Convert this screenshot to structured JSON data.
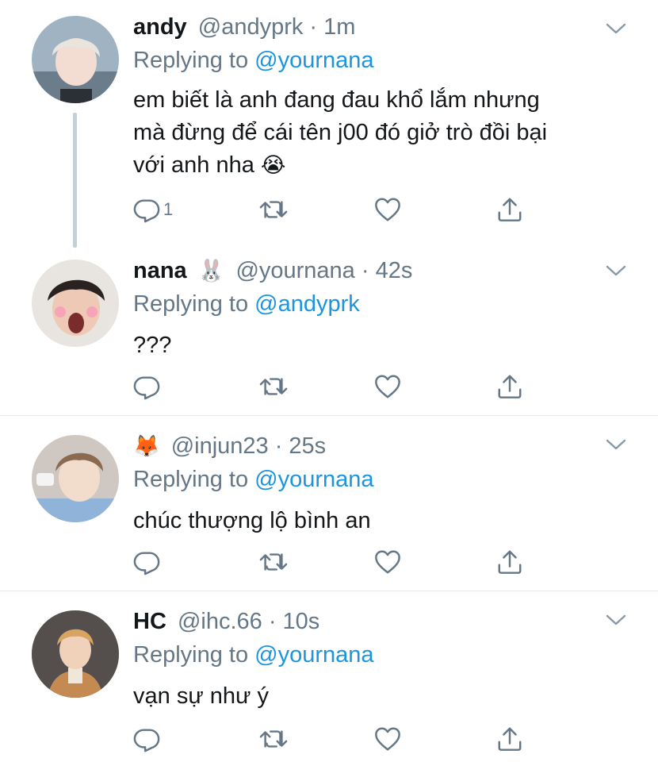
{
  "tweets": [
    {
      "name": "andy",
      "handle": "@andyprk · 1m",
      "replying_prefix": "Replying to ",
      "replying_to": "@yournana",
      "text_lines": [
        "em biết là anh đang đau khổ lắm nhưng",
        "mà đừng để cái tên j00 đó giở trò đồi bại",
        "với anh nha"
      ],
      "text_emoji": "😭",
      "reply_count": "1"
    },
    {
      "name": "nana",
      "name_emoji": "🐰",
      "handle": "@yournana · 42s",
      "replying_prefix": "Replying to ",
      "replying_to": "@andyprk",
      "text": "???"
    },
    {
      "name_emoji": "🦊",
      "handle": "@injun23 · 25s",
      "replying_prefix": "Replying to ",
      "replying_to": "@yournana",
      "text": "chúc thượng lộ bình an"
    },
    {
      "name": "HC",
      "handle": "@ihc.66 · 10s",
      "replying_prefix": "Replying to ",
      "replying_to": "@yournana",
      "text": "vạn sự như ý"
    }
  ],
  "colors": {
    "text": "#14171a",
    "secondary": "#657786",
    "link": "#1b95e0",
    "divider": "#e6ecf0",
    "thread": "#c4cfd6"
  },
  "icons": [
    "reply-icon",
    "retweet-icon",
    "like-icon",
    "share-icon",
    "chevron-down-icon"
  ]
}
